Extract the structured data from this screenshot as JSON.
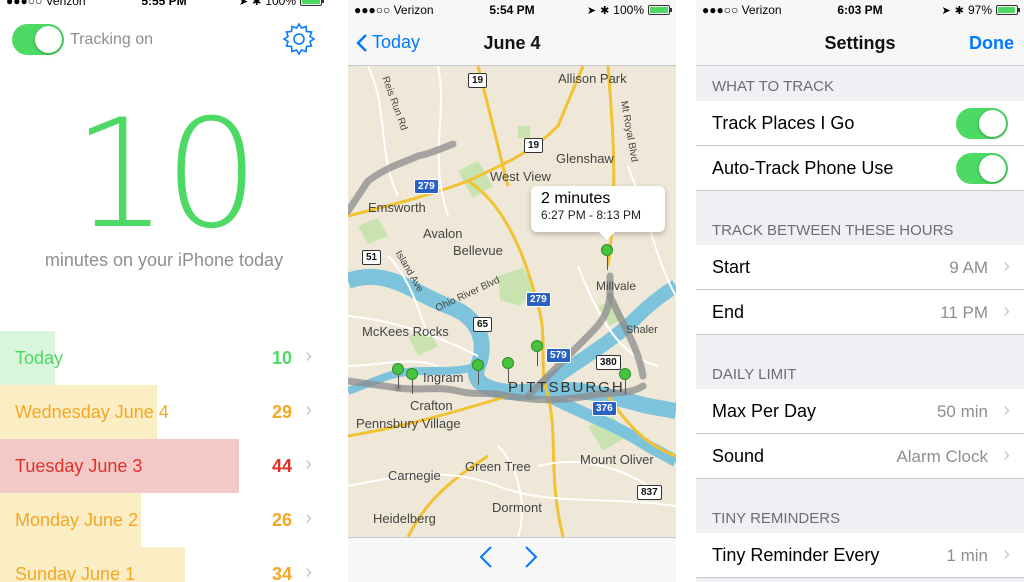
{
  "panel1": {
    "status": {
      "carrier": "●●●○○ Verizon",
      "time": "5:55 PM",
      "battery": "100%"
    },
    "tracking_label": "Tracking on",
    "big_number": "10",
    "caption": "minutes on your iPhone today",
    "days": [
      {
        "label": "Today",
        "value": "10",
        "fraction": 0.167,
        "color": "#4cd964",
        "bg": "#d9f5db"
      },
      {
        "label": "Wednesday June 4",
        "value": "29",
        "fraction": 0.48,
        "color": "#f5a623",
        "bg": "#fbeec5"
      },
      {
        "label": "Tuesday June 3",
        "value": "44",
        "fraction": 0.73,
        "color": "#e0312b",
        "bg": "#f3c9c7"
      },
      {
        "label": "Monday June 2",
        "value": "26",
        "fraction": 0.43,
        "color": "#f5a623",
        "bg": "#fbeec5"
      },
      {
        "label": "Sunday June 1",
        "value": "34",
        "fraction": 0.565,
        "color": "#f5a623",
        "bg": "#fbeec5"
      }
    ]
  },
  "panel2": {
    "status": {
      "carrier": "●●●○○ Verizon",
      "time": "5:54 PM",
      "battery": "100%"
    },
    "back_label": "Today",
    "title": "June 4",
    "callout_title": "2 minutes",
    "callout_sub": "6:27 PM - 8:13 PM",
    "map_labels": [
      {
        "text": "Allison Park",
        "cls": "l1"
      },
      {
        "text": "Glenshaw",
        "cls": "l2"
      },
      {
        "text": "West View",
        "cls": "l3"
      },
      {
        "text": "Emsworth",
        "cls": "l4"
      },
      {
        "text": "Avalon",
        "cls": "l5"
      },
      {
        "text": "Bellevue",
        "cls": "l6"
      },
      {
        "text": "McKees Rocks",
        "cls": "l7"
      },
      {
        "text": "Ingram",
        "cls": "l8"
      },
      {
        "text": "PITTSBURGH",
        "cls": "l9"
      },
      {
        "text": "Crafton",
        "cls": "l10"
      },
      {
        "text": "Pennsbury Village",
        "cls": "l11"
      },
      {
        "text": "Green Tree",
        "cls": "l12"
      },
      {
        "text": "Mount Oliver",
        "cls": "l13"
      },
      {
        "text": "Carnegie",
        "cls": "l14"
      },
      {
        "text": "Dormont",
        "cls": "l15"
      },
      {
        "text": "Heidelberg",
        "cls": "l16"
      },
      {
        "text": "Millvale",
        "cls": "l17"
      },
      {
        "text": "Shaler",
        "cls": "l18"
      },
      {
        "text": "Island Ave",
        "cls": "l19"
      },
      {
        "text": "Reis Run Rd",
        "cls": "l20"
      },
      {
        "text": "Mt Royal Blvd",
        "cls": "l21"
      },
      {
        "text": "Ohio River Blvd",
        "cls": "l22"
      }
    ],
    "shields": [
      {
        "text": "19",
        "cls": "s1"
      },
      {
        "text": "19",
        "cls": "s2"
      },
      {
        "text": "279",
        "cls": "s3"
      },
      {
        "text": "51",
        "cls": "s4"
      },
      {
        "text": "279",
        "cls": "s5"
      },
      {
        "text": "65",
        "cls": "s6"
      },
      {
        "text": "579",
        "cls": "s7"
      },
      {
        "text": "380",
        "cls": "s8"
      },
      {
        "text": "376",
        "cls": "s9"
      },
      {
        "text": "837",
        "cls": "s10"
      }
    ]
  },
  "panel3": {
    "status": {
      "carrier": "●●●○○ Verizon",
      "time": "6:03 PM",
      "battery": "97%"
    },
    "title": "Settings",
    "done_label": "Done",
    "sections": {
      "what": "WHAT TO TRACK",
      "hours": "TRACK BETWEEN THESE HOURS",
      "limit": "DAILY LIMIT",
      "tiny": "TINY REMINDERS"
    },
    "track_places": "Track Places I Go",
    "auto_track": "Auto-Track Phone Use",
    "start_label": "Start",
    "start_value": "9 AM",
    "end_label": "End",
    "end_value": "11 PM",
    "max_label": "Max Per Day",
    "max_value": "50 min",
    "sound_label": "Sound",
    "sound_value": "Alarm Clock",
    "tiny_label": "Tiny Reminder Every",
    "tiny_value": "1 min"
  },
  "colors": {
    "accent": "#007aff",
    "green": "#4cd964"
  }
}
